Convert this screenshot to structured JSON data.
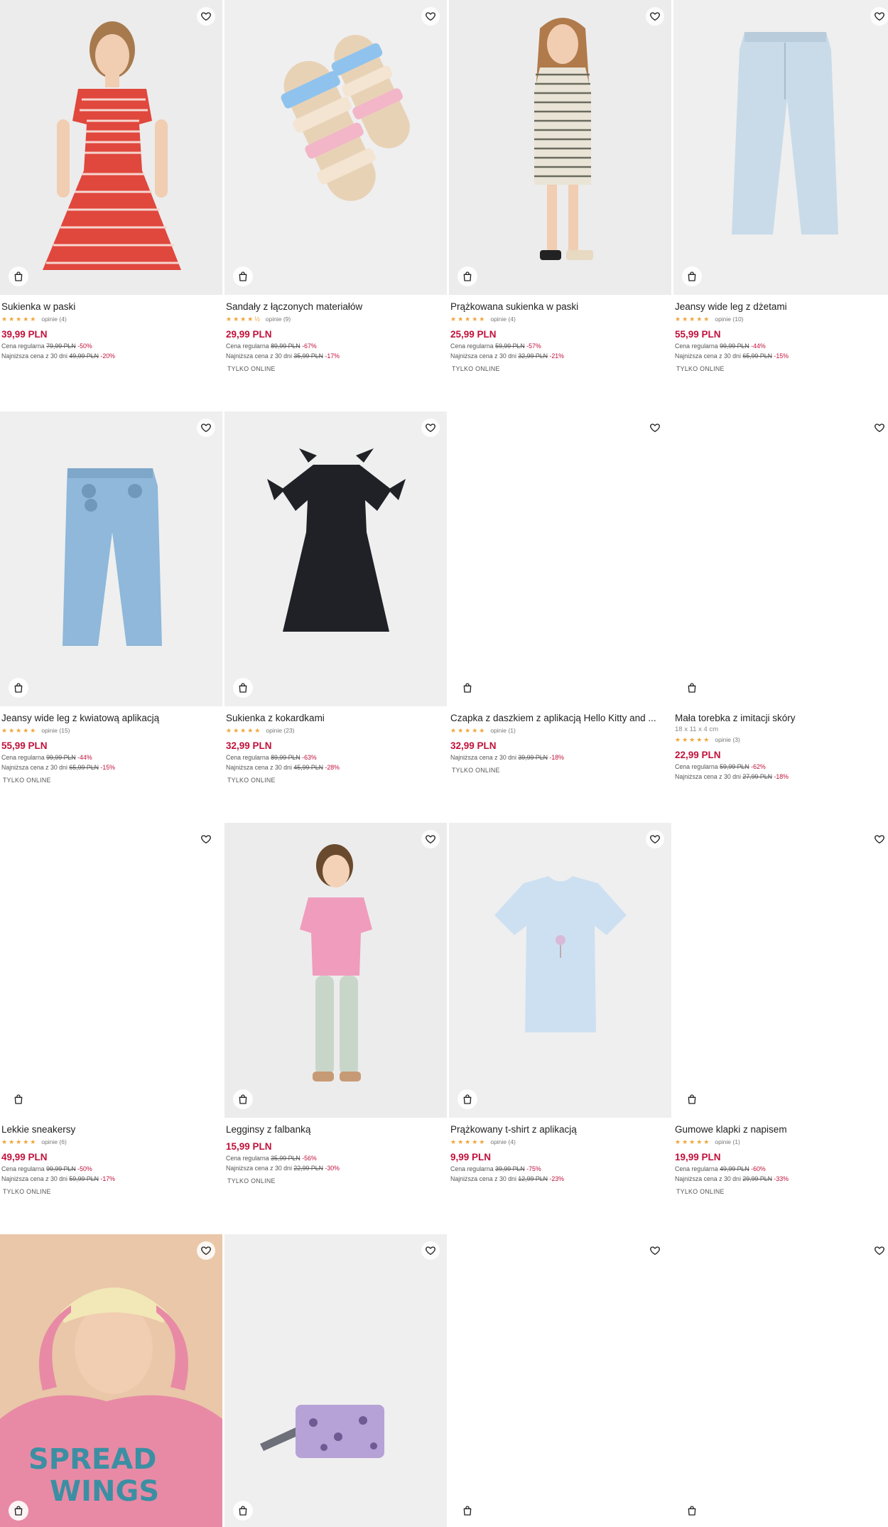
{
  "colors": {
    "price": "#c1113a",
    "stars": "#f0a53a",
    "image_bg": "#ededed"
  },
  "icons": {
    "wishlist": "heart-outline-icon",
    "add_to_cart": "shopping-bag-icon"
  },
  "products": [
    {
      "name": "Sukienka w paski",
      "stars": "★★★★★",
      "reviews": "opinie (4)",
      "price": "39,99 PLN",
      "regular_label": "Cena regularna",
      "regular_price": "79,99 PLN",
      "regular_discount": "-50%",
      "lowest_label": "Najniższa cena z 30 dni",
      "lowest_price": "49,99 PLN",
      "lowest_discount": "-20%",
      "online": ""
    },
    {
      "name": "Sandały z łączonych materiałów",
      "stars": "★★★★½",
      "reviews": "opinie (9)",
      "price": "29,99 PLN",
      "regular_label": "Cena regularna",
      "regular_price": "89,99 PLN",
      "regular_discount": "-67%",
      "lowest_label": "Najniższa cena z 30 dni",
      "lowest_price": "35,99 PLN",
      "lowest_discount": "-17%",
      "online": "TYLKO ONLINE"
    },
    {
      "name": "Prążkowana sukienka w paski",
      "stars": "★★★★★",
      "reviews": "opinie (4)",
      "price": "25,99 PLN",
      "regular_label": "Cena regularna",
      "regular_price": "59,99 PLN",
      "regular_discount": "-57%",
      "lowest_label": "Najniższa cena z 30 dni",
      "lowest_price": "32,99 PLN",
      "lowest_discount": "-21%",
      "online": "TYLKO ONLINE"
    },
    {
      "name": "Jeansy wide leg z dżetami",
      "stars": "★★★★★",
      "reviews": "opinie (10)",
      "price": "55,99 PLN",
      "regular_label": "Cena regularna",
      "regular_price": "99,99 PLN",
      "regular_discount": "-44%",
      "lowest_label": "Najniższa cena z 30 dni",
      "lowest_price": "65,99 PLN",
      "lowest_discount": "-15%",
      "online": "TYLKO ONLINE"
    },
    {
      "name": "Jeansy wide leg z kwiatową aplikacją",
      "stars": "★★★★★",
      "reviews": "opinie (15)",
      "price": "55,99 PLN",
      "regular_label": "Cena regularna",
      "regular_price": "99,99 PLN",
      "regular_discount": "-44%",
      "lowest_label": "Najniższa cena z 30 dni",
      "lowest_price": "65,99 PLN",
      "lowest_discount": "-15%",
      "online": "TYLKO ONLINE"
    },
    {
      "name": "Sukienka z kokardkami",
      "stars": "★★★★★",
      "reviews": "opinie (23)",
      "price": "32,99 PLN",
      "regular_label": "Cena regularna",
      "regular_price": "89,99 PLN",
      "regular_discount": "-63%",
      "lowest_label": "Najniższa cena z 30 dni",
      "lowest_price": "45,99 PLN",
      "lowest_discount": "-28%",
      "online": "TYLKO ONLINE"
    },
    {
      "name": "Czapka z daszkiem z aplikacją Hello Kitty and ...",
      "stars": "★★★★★",
      "reviews": "opinie (1)",
      "price": "32,99 PLN",
      "lowest_label": "Najniższa cena z 30 dni",
      "lowest_price": "39,99 PLN",
      "lowest_discount": "-18%",
      "online": "TYLKO ONLINE"
    },
    {
      "name": "Mała torebka z imitacji skóry",
      "dims": "18 x 11 x 4 cm",
      "stars": "★★★★★",
      "reviews": "opinie (3)",
      "price": "22,99 PLN",
      "regular_label": "Cena regularna",
      "regular_price": "59,99 PLN",
      "regular_discount": "-62%",
      "lowest_label": "Najniższa cena z 30 dni",
      "lowest_price": "27,99 PLN",
      "lowest_discount": "-18%",
      "online": ""
    },
    {
      "name": "Lekkie sneakersy",
      "stars": "★★★★★",
      "reviews": "opinie (6)",
      "price": "49,99 PLN",
      "regular_label": "Cena regularna",
      "regular_price": "99,99 PLN",
      "regular_discount": "-50%",
      "lowest_label": "Najniższa cena z 30 dni",
      "lowest_price": "59,99 PLN",
      "lowest_discount": "-17%",
      "online": "TYLKO ONLINE"
    },
    {
      "name": "Legginsy z falbanką",
      "price": "15,99 PLN",
      "regular_label": "Cena regularna",
      "regular_price": "35,99 PLN",
      "regular_discount": "-56%",
      "lowest_label": "Najniższa cena z 30 dni",
      "lowest_price": "22,99 PLN",
      "lowest_discount": "-30%",
      "online": "TYLKO ONLINE"
    },
    {
      "name": "Prążkowany t-shirt z aplikacją",
      "stars": "★★★★★",
      "reviews": "opinie (4)",
      "price": "9,99 PLN",
      "regular_label": "Cena regularna",
      "regular_price": "39,99 PLN",
      "regular_discount": "-75%",
      "lowest_label": "Najniższa cena z 30 dni",
      "lowest_price": "12,99 PLN",
      "lowest_discount": "-23%",
      "online": ""
    },
    {
      "name": "Gumowe klapki z napisem",
      "stars": "★★★★★",
      "reviews": "opinie (1)",
      "price": "19,99 PLN",
      "regular_label": "Cena regularna",
      "regular_price": "49,99 PLN",
      "regular_discount": "-60%",
      "lowest_label": "Najniższa cena z 30 dni",
      "lowest_price": "29,99 PLN",
      "lowest_discount": "-33%",
      "online": "TYLKO ONLINE"
    },
    {
      "name": ""
    },
    {
      "name": ""
    },
    {
      "name": ""
    },
    {
      "name": ""
    }
  ]
}
